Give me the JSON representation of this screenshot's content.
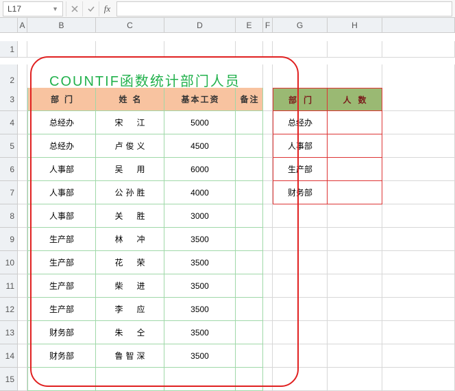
{
  "formula_bar": {
    "cell_ref": "L17",
    "formula": ""
  },
  "columns": [
    "A",
    "B",
    "C",
    "D",
    "E",
    "F",
    "G",
    "H"
  ],
  "rows": [
    "1",
    "2",
    "3",
    "4",
    "5",
    "6",
    "7",
    "8",
    "9",
    "10",
    "11",
    "12",
    "13",
    "14",
    "15"
  ],
  "title": "COUNTIF函数统计部门人员",
  "main_headers": {
    "dept": "部门",
    "name": "姓名",
    "salary": "基本工资",
    "note": "备注"
  },
  "main_rows": [
    {
      "dept": "总经办",
      "name": "宋　江",
      "salary": "5000"
    },
    {
      "dept": "总经办",
      "name": "卢俊义",
      "salary": "4500"
    },
    {
      "dept": "人事部",
      "name": "吴　用",
      "salary": "6000"
    },
    {
      "dept": "人事部",
      "name": "公孙胜",
      "salary": "4000"
    },
    {
      "dept": "人事部",
      "name": "关　胜",
      "salary": "3000"
    },
    {
      "dept": "生产部",
      "name": "林　冲",
      "salary": "3500"
    },
    {
      "dept": "生产部",
      "name": "花　荣",
      "salary": "3500"
    },
    {
      "dept": "生产部",
      "name": "柴　进",
      "salary": "3500"
    },
    {
      "dept": "生产部",
      "name": "李　应",
      "salary": "3500"
    },
    {
      "dept": "财务部",
      "name": "朱　仝",
      "salary": "3500"
    },
    {
      "dept": "财务部",
      "name": "鲁智深",
      "salary": "3500"
    }
  ],
  "summary_headers": {
    "dept": "部门",
    "count": "人数"
  },
  "summary_rows": [
    {
      "dept": "总经办",
      "count": ""
    },
    {
      "dept": "人事部",
      "count": ""
    },
    {
      "dept": "生产部",
      "count": ""
    },
    {
      "dept": "财务部",
      "count": ""
    }
  ]
}
